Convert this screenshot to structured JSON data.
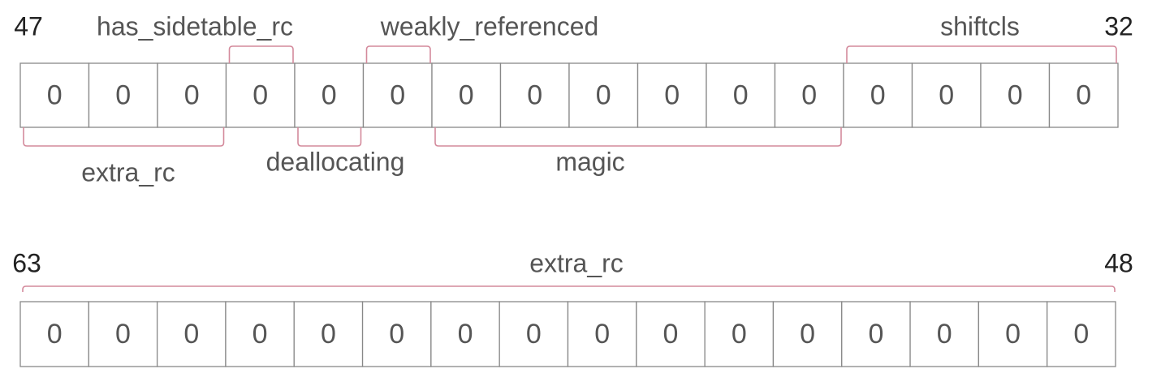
{
  "top_row": {
    "high_bit": "47",
    "low_bit": "32",
    "bits": [
      "0",
      "0",
      "0",
      "0",
      "0",
      "0",
      "0",
      "0",
      "0",
      "0",
      "0",
      "0",
      "0",
      "0",
      "0",
      "0"
    ],
    "fields_above": [
      {
        "label": "has_sidetable_rc",
        "from_cell": 3,
        "to_cell": 3
      },
      {
        "label": "weakly_referenced",
        "from_cell": 5,
        "to_cell": 5
      },
      {
        "label": "shiftcls",
        "from_cell": 12,
        "to_cell": 15
      }
    ],
    "fields_below": [
      {
        "label": "extra_rc",
        "from_cell": 0,
        "to_cell": 2
      },
      {
        "label": "deallocating",
        "from_cell": 4,
        "to_cell": 4
      },
      {
        "label": "magic",
        "from_cell": 6,
        "to_cell": 11
      }
    ]
  },
  "bottom_row": {
    "high_bit": "63",
    "low_bit": "48",
    "bits": [
      "0",
      "0",
      "0",
      "0",
      "0",
      "0",
      "0",
      "0",
      "0",
      "0",
      "0",
      "0",
      "0",
      "0",
      "0",
      "0"
    ],
    "field_above": {
      "label": "extra_rc",
      "from_cell": 0,
      "to_cell": 15
    }
  },
  "colors": {
    "bracket": "#d48a9c",
    "cell_border": "#888888",
    "text": "#555555"
  }
}
